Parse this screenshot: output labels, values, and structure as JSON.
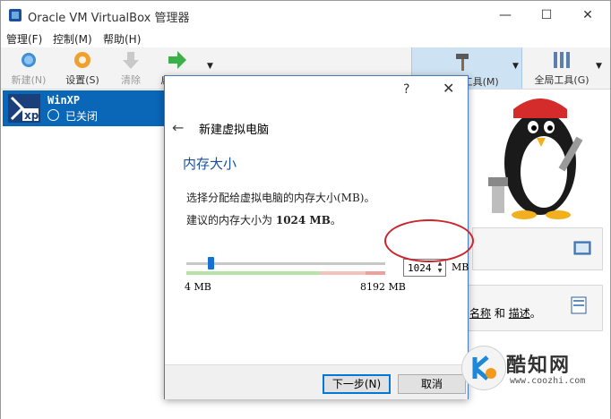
{
  "window": {
    "title": "Oracle VM VirtualBox 管理器",
    "min_glyph": "—",
    "max_glyph": "☐",
    "close_glyph": "✕"
  },
  "menu": [
    "管理(F)",
    "控制(M)",
    "帮助(H)"
  ],
  "toolbar": {
    "new_label": "新建(N)",
    "settings_label": "设置(S)",
    "discard_label": "清除",
    "start_label": "启动(T)",
    "machine_tools_label": "备份(快照)工具(M)",
    "global_tools_label": "全局工具(G)"
  },
  "vm": {
    "name": "WinXP",
    "state": "已关闭",
    "logo_text": "xp"
  },
  "right_pane": {
    "name_link": "名称",
    "and_text": "和",
    "desc_link": "描述"
  },
  "dialog": {
    "help_glyph": "?",
    "close_glyph": "✕",
    "back_glyph": "←",
    "title": "新建虚拟电脑",
    "page_title": "内存大小",
    "desc_line1": "选择分配给虚拟电脑的内存大小(MB)。",
    "desc_line2_prefix": "建议的内存大小为",
    "recommended": "1024 MB",
    "desc_line2_suffix": "。",
    "slider_min": "4 MB",
    "slider_max": "8192 MB",
    "memory_value": "1024",
    "memory_unit": "MB",
    "memory_fraction": 0.125,
    "next_button": "下一步(N)",
    "cancel_button": "取消"
  },
  "watermark": {
    "brand": "酷知网",
    "url": "www.coozhi.com"
  },
  "colors": {
    "selection": "#0a66b7",
    "tools_selected": "#cde2f3",
    "highlight_circle": "#c8262c",
    "page_title": "#1b4f9b"
  }
}
